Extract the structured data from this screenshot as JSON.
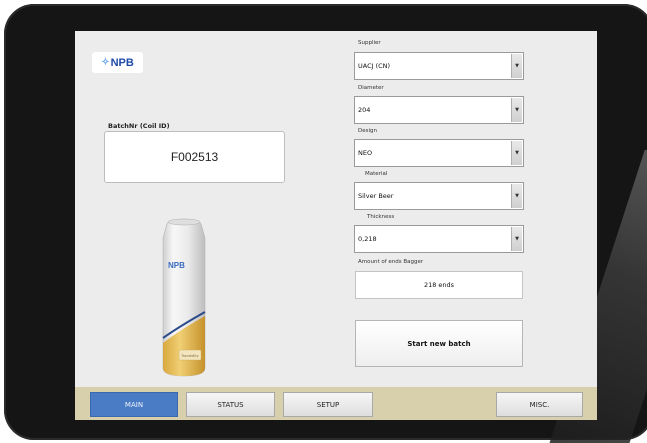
{
  "logo": {
    "text": "NPB",
    "spark": "✧"
  },
  "batch": {
    "label": "BatchNr (Coil ID)",
    "value": "F002513"
  },
  "form": {
    "supplier": {
      "label": "Supplier",
      "value": "UACJ (CN)"
    },
    "diameter": {
      "label": "Diameter",
      "value": "204"
    },
    "design": {
      "label": "Design",
      "value": "NEO"
    },
    "material": {
      "label": "Material",
      "value": "Silver Beer"
    },
    "thickness": {
      "label": "Thickness",
      "value": "0,218"
    },
    "ends": {
      "label": "Amount of ends Bagger",
      "value": "218 ends"
    },
    "start_label": "Start new batch"
  },
  "can": {
    "brand": "NPB",
    "badge": "Tracebility"
  },
  "nav": {
    "main": "MAIN",
    "status": "STATUS",
    "setup": "SETUP",
    "misc": "MISC.",
    "active": "main"
  },
  "colors": {
    "accent": "#4a7cc6",
    "navbar": "#d8d0ad",
    "logo_text": "#1f4aa8"
  }
}
